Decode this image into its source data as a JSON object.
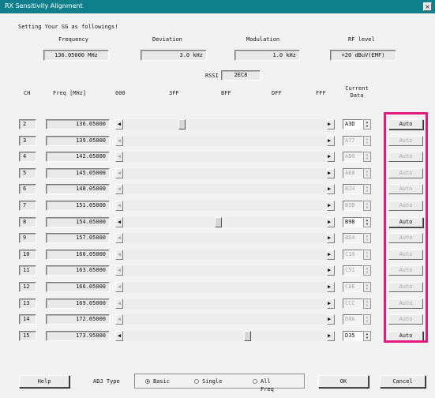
{
  "window": {
    "title": "RX Sensitivity Alignment",
    "close_glyph": "×"
  },
  "instructions": "Setting Your SG as followings!",
  "sg": {
    "frequency_label": "Frequency",
    "frequency_value": "136.05000 MHz",
    "deviation_label": "Deviation",
    "deviation_value": "3.0 kHz",
    "modulation_label": "Modulation",
    "modulation_value": "1.0 kHz",
    "rf_level_label": "RF level",
    "rf_level_value": "+20 dBuV(EMF)"
  },
  "rssi": {
    "label": "RSSI",
    "value": "2EC8"
  },
  "columns": {
    "ch": "CH",
    "freq": "Freq [MHz]",
    "c1": "000",
    "c2": "3FF",
    "c3": "BFF",
    "c4": "DFF",
    "c5": "FFF",
    "current_data": "Current\nData"
  },
  "rows": [
    {
      "ch": "2",
      "freq": "136.05000",
      "data": "A3D",
      "enabled": true,
      "level": 0.283
    },
    {
      "ch": "3",
      "freq": "139.05000",
      "data": "A77",
      "enabled": false,
      "level": null
    },
    {
      "ch": "4",
      "freq": "142.05000",
      "data": "AB0",
      "enabled": false,
      "level": null
    },
    {
      "ch": "5",
      "freq": "145.05000",
      "data": "AE8",
      "enabled": false,
      "level": null
    },
    {
      "ch": "6",
      "freq": "148.05000",
      "data": "B24",
      "enabled": false,
      "level": null
    },
    {
      "ch": "7",
      "freq": "151.05000",
      "data": "B5D",
      "enabled": false,
      "level": null
    },
    {
      "ch": "8",
      "freq": "154.05000",
      "data": "B98",
      "enabled": true,
      "level": 0.464
    },
    {
      "ch": "9",
      "freq": "157.05000",
      "data": "BD4",
      "enabled": false,
      "level": null
    },
    {
      "ch": "10",
      "freq": "160.05000",
      "data": "C10",
      "enabled": false,
      "level": null
    },
    {
      "ch": "11",
      "freq": "163.05000",
      "data": "C51",
      "enabled": false,
      "level": null
    },
    {
      "ch": "12",
      "freq": "166.05000",
      "data": "C8E",
      "enabled": false,
      "level": null
    },
    {
      "ch": "13",
      "freq": "169.05000",
      "data": "CCC",
      "enabled": false,
      "level": null
    },
    {
      "ch": "14",
      "freq": "172.05000",
      "data": "D0A",
      "enabled": false,
      "level": null
    },
    {
      "ch": "15",
      "freq": "173.95000",
      "data": "D35",
      "enabled": true,
      "level": 0.613
    }
  ],
  "auto_label": "Auto",
  "arrows": {
    "left": "◀",
    "right": "▶",
    "up": "▲",
    "down": "▼"
  },
  "buttons": {
    "help": "Help",
    "ok": "OK",
    "cancel": "Cancel"
  },
  "adj": {
    "label": "ADJ Type",
    "options": [
      "Basic",
      "Single",
      "All Freq"
    ],
    "selected": "Basic"
  },
  "colors": {
    "titlebar": "#0f7f8c",
    "highlight": "#e5197e"
  }
}
